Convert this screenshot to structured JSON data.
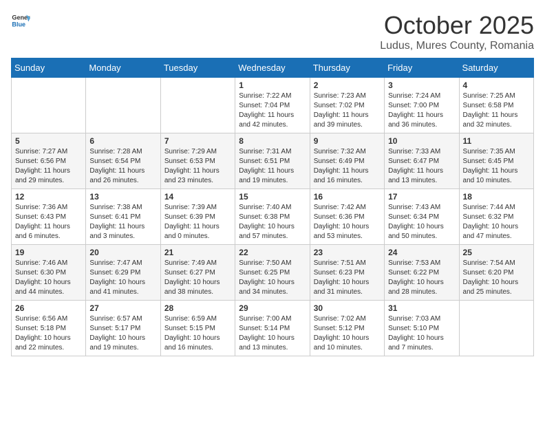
{
  "header": {
    "logo_general": "General",
    "logo_blue": "Blue",
    "month_title": "October 2025",
    "location": "Ludus, Mures County, Romania"
  },
  "weekdays": [
    "Sunday",
    "Monday",
    "Tuesday",
    "Wednesday",
    "Thursday",
    "Friday",
    "Saturday"
  ],
  "weeks": [
    [
      {
        "day": "",
        "info": ""
      },
      {
        "day": "",
        "info": ""
      },
      {
        "day": "",
        "info": ""
      },
      {
        "day": "1",
        "info": "Sunrise: 7:22 AM\nSunset: 7:04 PM\nDaylight: 11 hours\nand 42 minutes."
      },
      {
        "day": "2",
        "info": "Sunrise: 7:23 AM\nSunset: 7:02 PM\nDaylight: 11 hours\nand 39 minutes."
      },
      {
        "day": "3",
        "info": "Sunrise: 7:24 AM\nSunset: 7:00 PM\nDaylight: 11 hours\nand 36 minutes."
      },
      {
        "day": "4",
        "info": "Sunrise: 7:25 AM\nSunset: 6:58 PM\nDaylight: 11 hours\nand 32 minutes."
      }
    ],
    [
      {
        "day": "5",
        "info": "Sunrise: 7:27 AM\nSunset: 6:56 PM\nDaylight: 11 hours\nand 29 minutes."
      },
      {
        "day": "6",
        "info": "Sunrise: 7:28 AM\nSunset: 6:54 PM\nDaylight: 11 hours\nand 26 minutes."
      },
      {
        "day": "7",
        "info": "Sunrise: 7:29 AM\nSunset: 6:53 PM\nDaylight: 11 hours\nand 23 minutes."
      },
      {
        "day": "8",
        "info": "Sunrise: 7:31 AM\nSunset: 6:51 PM\nDaylight: 11 hours\nand 19 minutes."
      },
      {
        "day": "9",
        "info": "Sunrise: 7:32 AM\nSunset: 6:49 PM\nDaylight: 11 hours\nand 16 minutes."
      },
      {
        "day": "10",
        "info": "Sunrise: 7:33 AM\nSunset: 6:47 PM\nDaylight: 11 hours\nand 13 minutes."
      },
      {
        "day": "11",
        "info": "Sunrise: 7:35 AM\nSunset: 6:45 PM\nDaylight: 11 hours\nand 10 minutes."
      }
    ],
    [
      {
        "day": "12",
        "info": "Sunrise: 7:36 AM\nSunset: 6:43 PM\nDaylight: 11 hours\nand 6 minutes."
      },
      {
        "day": "13",
        "info": "Sunrise: 7:38 AM\nSunset: 6:41 PM\nDaylight: 11 hours\nand 3 minutes."
      },
      {
        "day": "14",
        "info": "Sunrise: 7:39 AM\nSunset: 6:39 PM\nDaylight: 11 hours\nand 0 minutes."
      },
      {
        "day": "15",
        "info": "Sunrise: 7:40 AM\nSunset: 6:38 PM\nDaylight: 10 hours\nand 57 minutes."
      },
      {
        "day": "16",
        "info": "Sunrise: 7:42 AM\nSunset: 6:36 PM\nDaylight: 10 hours\nand 53 minutes."
      },
      {
        "day": "17",
        "info": "Sunrise: 7:43 AM\nSunset: 6:34 PM\nDaylight: 10 hours\nand 50 minutes."
      },
      {
        "day": "18",
        "info": "Sunrise: 7:44 AM\nSunset: 6:32 PM\nDaylight: 10 hours\nand 47 minutes."
      }
    ],
    [
      {
        "day": "19",
        "info": "Sunrise: 7:46 AM\nSunset: 6:30 PM\nDaylight: 10 hours\nand 44 minutes."
      },
      {
        "day": "20",
        "info": "Sunrise: 7:47 AM\nSunset: 6:29 PM\nDaylight: 10 hours\nand 41 minutes."
      },
      {
        "day": "21",
        "info": "Sunrise: 7:49 AM\nSunset: 6:27 PM\nDaylight: 10 hours\nand 38 minutes."
      },
      {
        "day": "22",
        "info": "Sunrise: 7:50 AM\nSunset: 6:25 PM\nDaylight: 10 hours\nand 34 minutes."
      },
      {
        "day": "23",
        "info": "Sunrise: 7:51 AM\nSunset: 6:23 PM\nDaylight: 10 hours\nand 31 minutes."
      },
      {
        "day": "24",
        "info": "Sunrise: 7:53 AM\nSunset: 6:22 PM\nDaylight: 10 hours\nand 28 minutes."
      },
      {
        "day": "25",
        "info": "Sunrise: 7:54 AM\nSunset: 6:20 PM\nDaylight: 10 hours\nand 25 minutes."
      }
    ],
    [
      {
        "day": "26",
        "info": "Sunrise: 6:56 AM\nSunset: 5:18 PM\nDaylight: 10 hours\nand 22 minutes."
      },
      {
        "day": "27",
        "info": "Sunrise: 6:57 AM\nSunset: 5:17 PM\nDaylight: 10 hours\nand 19 minutes."
      },
      {
        "day": "28",
        "info": "Sunrise: 6:59 AM\nSunset: 5:15 PM\nDaylight: 10 hours\nand 16 minutes."
      },
      {
        "day": "29",
        "info": "Sunrise: 7:00 AM\nSunset: 5:14 PM\nDaylight: 10 hours\nand 13 minutes."
      },
      {
        "day": "30",
        "info": "Sunrise: 7:02 AM\nSunset: 5:12 PM\nDaylight: 10 hours\nand 10 minutes."
      },
      {
        "day": "31",
        "info": "Sunrise: 7:03 AM\nSunset: 5:10 PM\nDaylight: 10 hours\nand 7 minutes."
      },
      {
        "day": "",
        "info": ""
      }
    ]
  ]
}
